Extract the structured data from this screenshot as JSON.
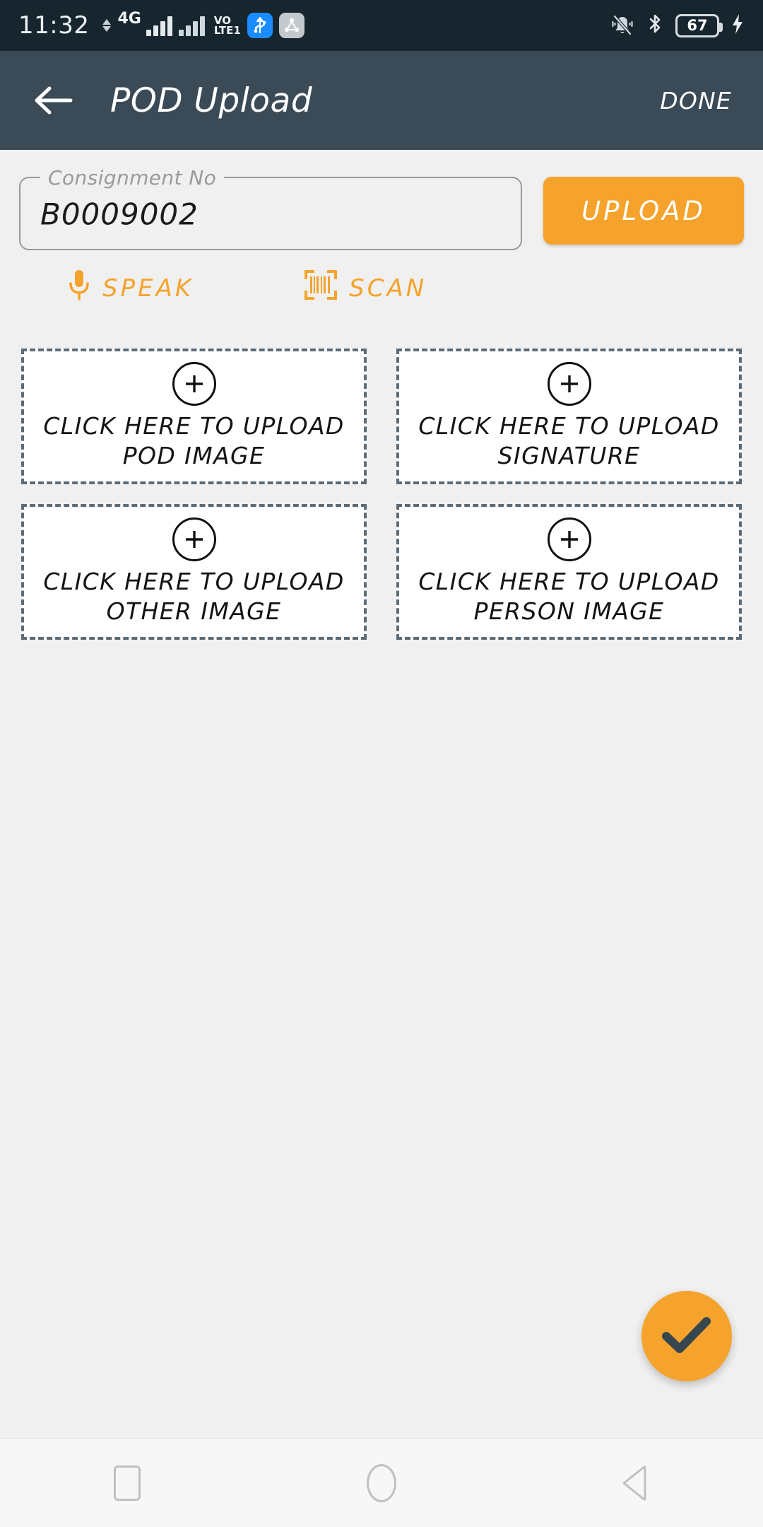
{
  "status_bar": {
    "time": "11:32",
    "network_generation": "4G",
    "volte_line1": "VO",
    "volte_line2": "LTE",
    "volte_sim": "1",
    "battery_percent": "67",
    "icons": {
      "signal_primary": "signal-bars-icon",
      "signal_secondary": "signal-bars-secondary-icon",
      "data_transfer": "data-updown-icon",
      "usb": "usb-icon",
      "cast": "cast-share-icon",
      "ringer": "ringer-silent-icon",
      "bluetooth": "bluetooth-icon",
      "battery": "battery-icon",
      "charging": "charging-bolt-icon"
    }
  },
  "app_bar": {
    "back_icon": "arrow-left-icon",
    "title": "POD Upload",
    "done_label": "DONE"
  },
  "form": {
    "consignment_label": "Consignment No",
    "consignment_value": "B0009002",
    "consignment_placeholder": "Consignment No",
    "upload_label": "UPLOAD"
  },
  "actions": [
    {
      "label": "SPEAK",
      "icon": "microphone-icon"
    },
    {
      "label": "SCAN",
      "icon": "barcode-scan-icon"
    }
  ],
  "upload_tiles": [
    {
      "line1": "CLICK HERE TO UPLOAD",
      "line2": "POD IMAGE"
    },
    {
      "line1": "CLICK HERE TO UPLOAD",
      "line2": "SIGNATURE"
    },
    {
      "line1": "CLICK HERE TO UPLOAD",
      "line2": "OTHER IMAGE"
    },
    {
      "line1": "CLICK HERE TO UPLOAD",
      "line2": "PERSON IMAGE"
    }
  ],
  "fab": {
    "icon": "check-icon"
  },
  "nav_bar": {
    "recents": "square-recents-icon",
    "home": "circle-home-icon",
    "back": "triangle-back-icon"
  },
  "colors": {
    "accent": "#f5a32c",
    "app_bar": "#3a4a56",
    "status_bar": "#16252e",
    "page_background": "#f0f0f0",
    "tile_border": "#5b6b78",
    "check_mark": "#37474f"
  }
}
